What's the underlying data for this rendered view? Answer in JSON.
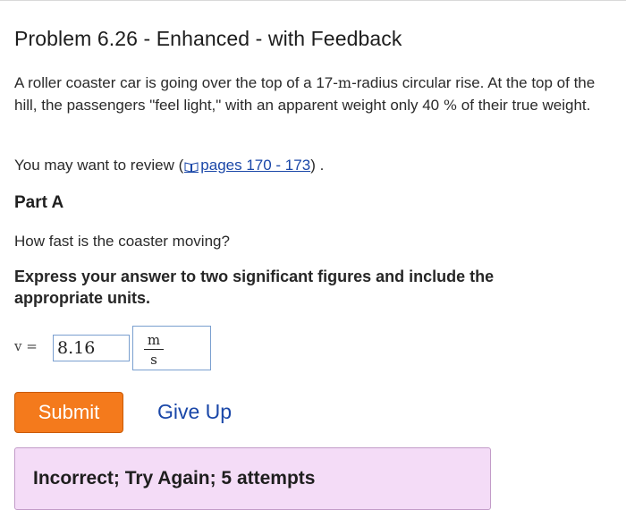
{
  "problem": {
    "title": "Problem 6.26 - Enhanced - with Feedback",
    "text_1": "A roller coaster car is going over the top of a 17-",
    "unit_m": "m",
    "text_2": "-radius circular rise. At the top of the hill, the passengers \"feel light,\" with an apparent weight only 40 ",
    "percent": "%",
    "text_3": " of their true weight."
  },
  "review": {
    "prefix": "You may want to review (",
    "link_label": "pages 170 - 173",
    "suffix": ") .",
    "icon": "book-icon"
  },
  "part": {
    "title": "Part A",
    "question": "How fast is the coaster moving?",
    "instruction": "Express your answer to two significant figures and include the appropriate units."
  },
  "answer": {
    "variable_label": "v =",
    "value": "8.16",
    "unit_numerator": "m",
    "unit_denominator": "s"
  },
  "buttons": {
    "submit": "Submit",
    "give_up": "Give Up"
  },
  "feedback": {
    "message": "Incorrect; Try Again; 5 attempts"
  },
  "colors": {
    "submit_bg": "#f47a1c",
    "link": "#1a47a8",
    "feedback_bg": "#f4dcf7"
  }
}
